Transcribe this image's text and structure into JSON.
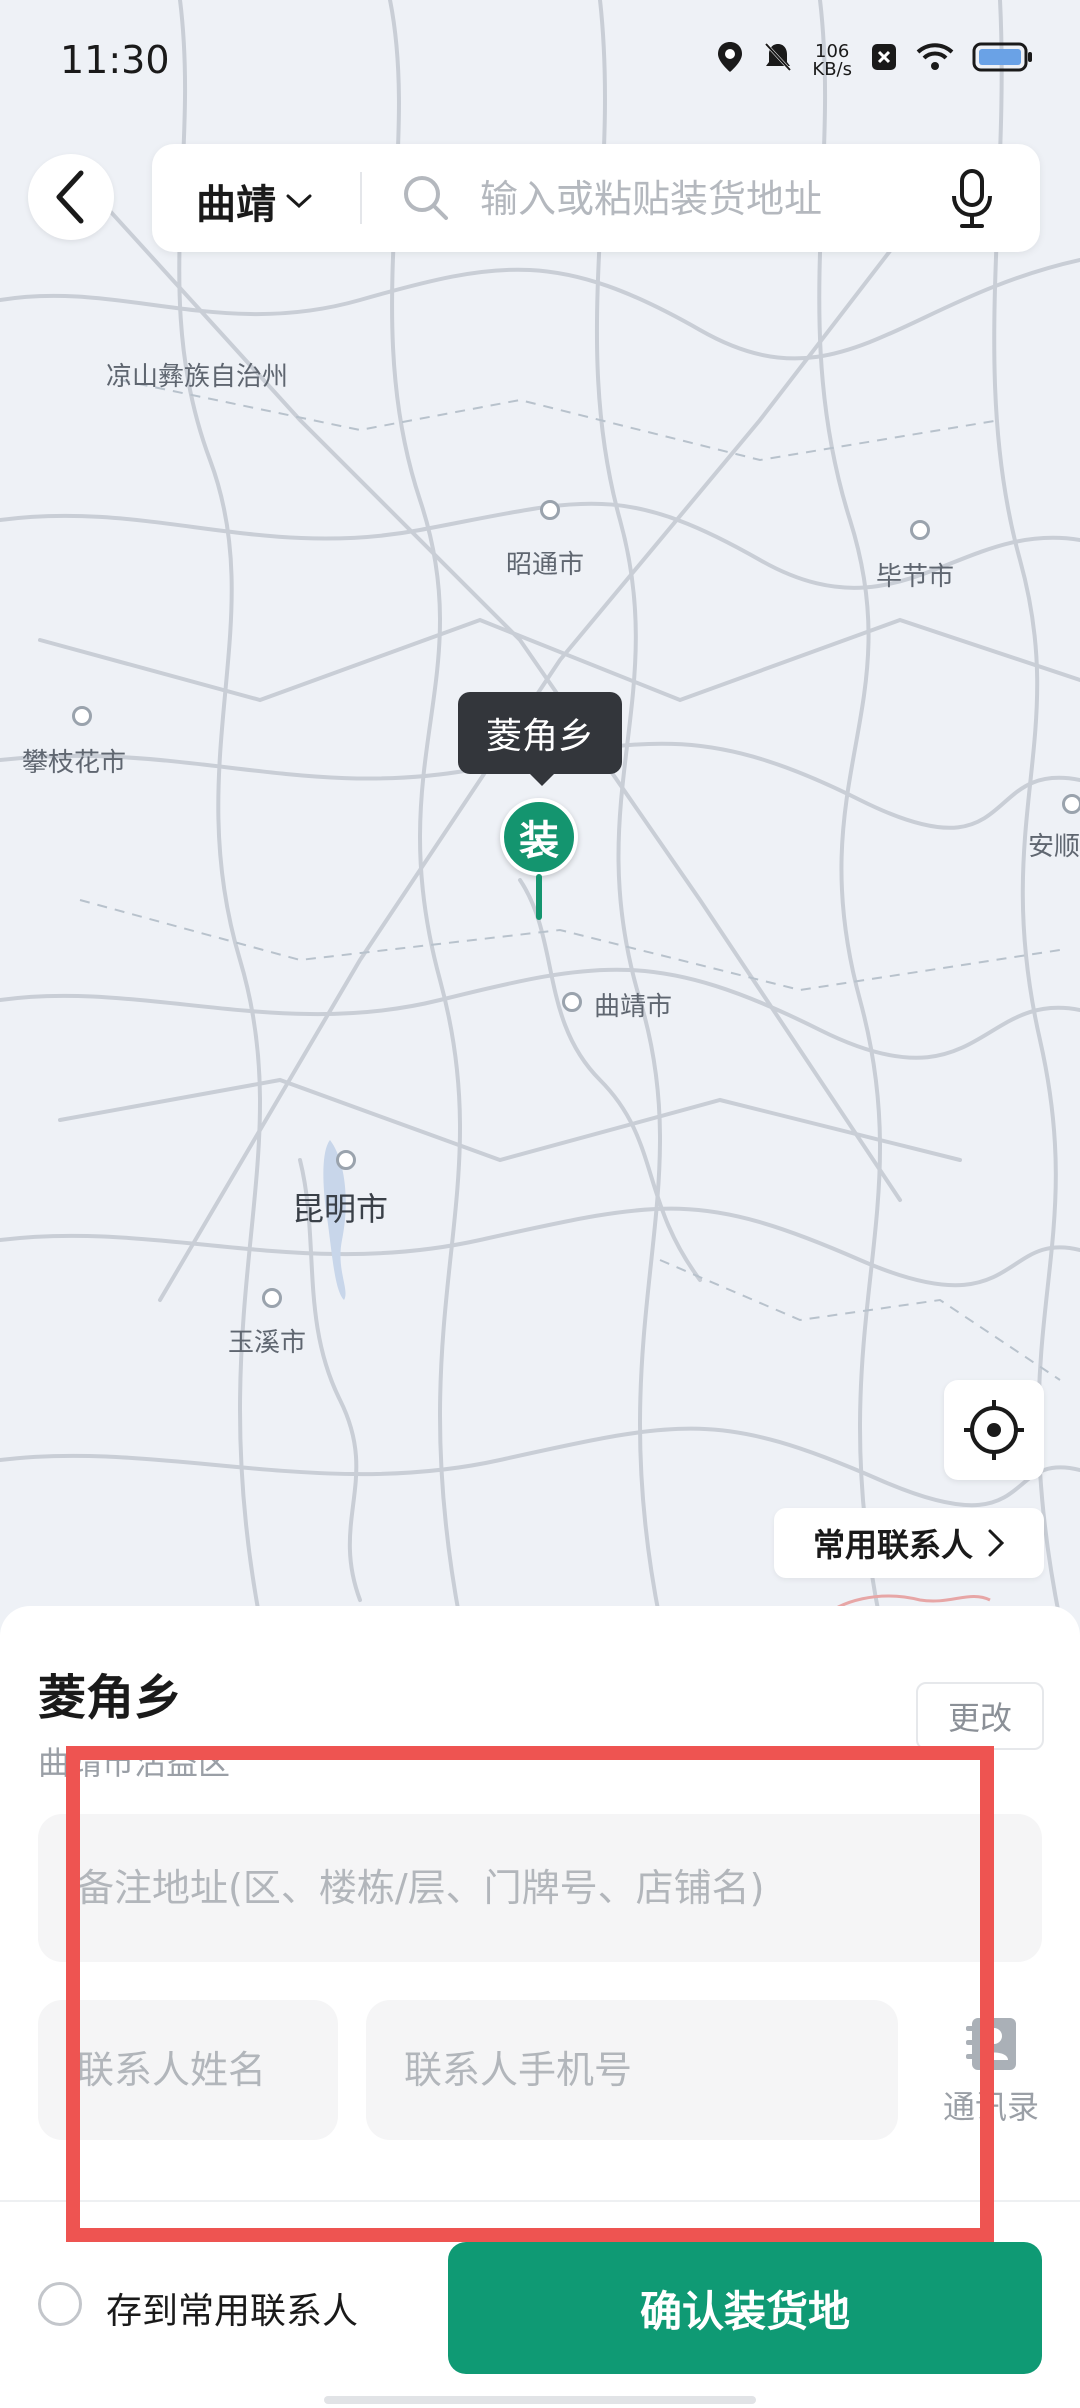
{
  "status_bar": {
    "time": "11:30",
    "speed_value": "106",
    "speed_unit": "KB/s",
    "icons": [
      "location-icon",
      "mute-icon",
      "close-box-icon",
      "wifi-icon",
      "battery-icon"
    ]
  },
  "header": {
    "city": "曲靖",
    "search_placeholder": "输入或粘贴装货地址"
  },
  "map": {
    "labels": {
      "liangshan": "凉山彝族自治州",
      "zhaotong": "昭通市",
      "bijie": "毕节市",
      "panzhihua": "攀枝花市",
      "anshun": "安顺",
      "qujing": "曲靖市",
      "kunming": "昆明市",
      "yuxi": "玉溪市"
    },
    "marker_tooltip": "菱角乡",
    "marker_badge": "装",
    "common_contacts": "常用联系人"
  },
  "sheet": {
    "title": "菱角乡",
    "subtitle": "曲靖市沾益区",
    "change_button": "更改",
    "address_placeholder": "备注地址(区、楼栋/层、门牌号、店铺名)",
    "name_placeholder": "联系人姓名",
    "phone_placeholder": "联系人手机号",
    "address_book": "通讯录",
    "save_contact": "存到常用联系人",
    "confirm": "确认装货地"
  },
  "colors": {
    "accent": "#0f9a74",
    "highlight": "#ee5451"
  }
}
